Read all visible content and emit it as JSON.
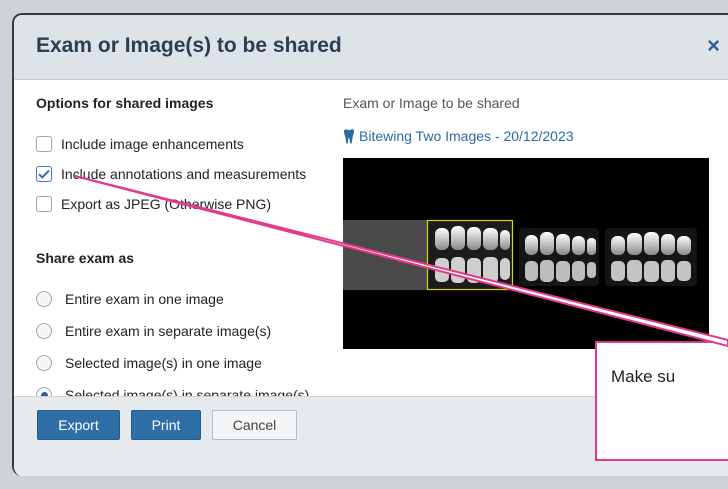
{
  "dialog": {
    "title": "Exam or Image(s) to be shared",
    "close_glyph": "×"
  },
  "options": {
    "heading": "Options for shared images",
    "items": [
      {
        "label": "Include image enhancements",
        "checked": false
      },
      {
        "label": "Include annotations and measurements",
        "checked": true
      },
      {
        "label": "Export as JPEG (Otherwise PNG)",
        "checked": false
      }
    ]
  },
  "share_as": {
    "heading": "Share exam as",
    "items": [
      {
        "label": "Entire exam in one image",
        "selected": false
      },
      {
        "label": "Entire exam in separate image(s)",
        "selected": false
      },
      {
        "label": "Selected image(s) in one image",
        "selected": false
      },
      {
        "label": "Selected image(s) in separate image(s)",
        "selected": true
      }
    ]
  },
  "preview": {
    "heading": "Exam or Image to be shared",
    "exam_label": "Bitewing Two Images - 20/12/2023",
    "exam_icon": "tooth-icon"
  },
  "buttons": {
    "export": "Export",
    "print": "Print",
    "cancel": "Cancel"
  },
  "callout": {
    "text": "Make su"
  },
  "colors": {
    "accent": "#2f6fa8",
    "link": "#2b6aa5",
    "annotation": "#e13a8c",
    "selection": "#d6d600"
  }
}
